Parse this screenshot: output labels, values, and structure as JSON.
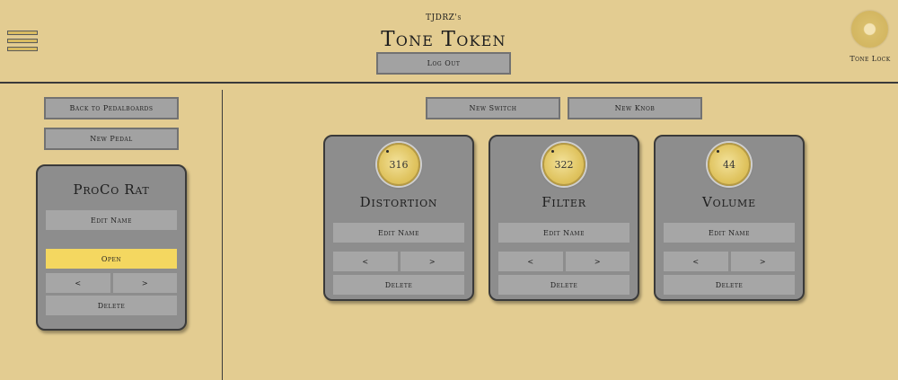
{
  "header": {
    "user": "TJDRZ's",
    "title": "Tone Token",
    "logout_label": "Log Out",
    "tone_lock_label": "Tone Lock"
  },
  "sidebar": {
    "back_label": "Back to Pedalboards",
    "new_pedal_label": "New Pedal",
    "pedal": {
      "name": "ProCo Rat",
      "edit_name_label": "Edit Name",
      "open_label": "Open",
      "prev_label": "<",
      "next_label": ">",
      "delete_label": "Delete"
    }
  },
  "main": {
    "new_switch_label": "New Switch",
    "new_knob_label": "New Knob",
    "knobs": [
      {
        "name": "Distortion",
        "value": "316",
        "edit_name_label": "Edit Name",
        "prev_label": "<",
        "next_label": ">",
        "delete_label": "Delete"
      },
      {
        "name": "Filter",
        "value": "322",
        "edit_name_label": "Edit Name",
        "prev_label": "<",
        "next_label": ">",
        "delete_label": "Delete"
      },
      {
        "name": "Volume",
        "value": "44",
        "edit_name_label": "Edit Name",
        "prev_label": "<",
        "next_label": ">",
        "delete_label": "Delete"
      }
    ]
  },
  "colors": {
    "background": "#e3cc91",
    "card": "#8d8d8d",
    "button": "#a2a2a2",
    "accent_open": "#f4d760",
    "knob": "#e0c460"
  }
}
